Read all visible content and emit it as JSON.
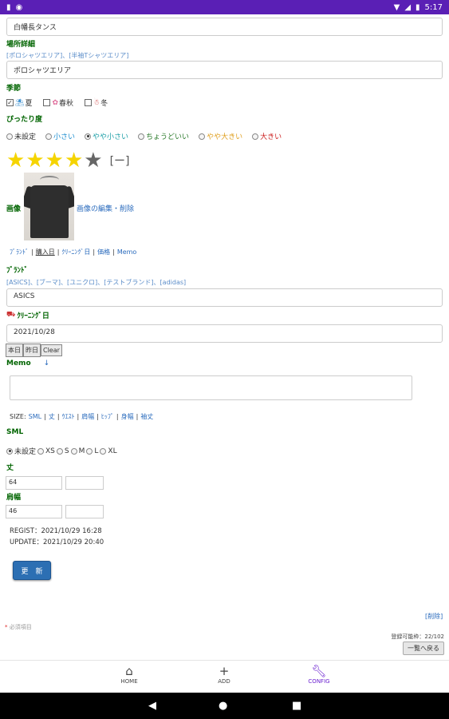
{
  "status": {
    "time": "5:17"
  },
  "top_field": {
    "value": "白幡長タンス"
  },
  "location_detail": {
    "label": "場所詳細",
    "hint": "[ポロシャツエリア]、[半袖Tシャツエリア]",
    "value": "ポロシャツエリア"
  },
  "season": {
    "label": "季節",
    "options": [
      {
        "label": "夏",
        "checked": true
      },
      {
        "label": "春秋",
        "checked": false
      },
      {
        "label": "冬",
        "checked": false
      }
    ]
  },
  "fit": {
    "label": "ぴったり度",
    "options": [
      {
        "label": "未設定",
        "color": "#333333",
        "selected": false
      },
      {
        "label": "小さい",
        "color": "#1f8fd0",
        "selected": false
      },
      {
        "label": "やや小さい",
        "color": "#1fa0a8",
        "selected": true
      },
      {
        "label": "ちょうどいい",
        "color": "#2a7a2a",
        "selected": false
      },
      {
        "label": "やや大きい",
        "color": "#e0a020",
        "selected": false
      },
      {
        "label": "大きい",
        "color": "#cc2222",
        "selected": false
      }
    ]
  },
  "rating": {
    "value": 4,
    "max": 5,
    "clear_label": "[ー]"
  },
  "image": {
    "label": "画像",
    "edit_link": "画像の編集・削除"
  },
  "tabs_line": [
    "ﾌﾞﾗﾝﾄﾞ",
    "購入日",
    "ｸﾘｰﾆﾝｸﾞ日",
    "価格",
    "Memo"
  ],
  "brand": {
    "label": "ﾌﾞﾗﾝﾄﾞ",
    "hint": "[ASICS]、[ブーマ]、[ユニクロ]、[テストブランド]、[adidas]",
    "value": "ASICS"
  },
  "cleaning": {
    "label": "ｸﾘｰﾆﾝｸﾞ日",
    "value": "2021/10/28",
    "buttons": [
      "本日",
      "昨日",
      "Clear"
    ]
  },
  "memo": {
    "label": "Memo",
    "arrow": "↓",
    "value": ""
  },
  "size_line": {
    "prefix": "SIZE:",
    "items": [
      "SML",
      "丈",
      "ｳｴｽﾄ",
      "肩幅",
      "ﾋｯﾌﾟ",
      "身幅",
      "袖丈"
    ]
  },
  "sml": {
    "label": "SML",
    "options": [
      {
        "label": "未設定",
        "selected": true
      },
      {
        "label": "XS",
        "selected": false
      },
      {
        "label": "S",
        "selected": false
      },
      {
        "label": "M",
        "selected": false
      },
      {
        "label": "L",
        "selected": false
      },
      {
        "label": "XL",
        "selected": false
      }
    ]
  },
  "length": {
    "label": "丈",
    "value": "64",
    "value2": ""
  },
  "shoulder": {
    "label": "肩幅",
    "value": "46",
    "value2": ""
  },
  "meta": {
    "regist": "REGIST：2021/10/29 16:28",
    "update": "UPDATE：2021/10/29 20:40"
  },
  "update_button": "更　新",
  "delete_link": "[削除]",
  "required_note": "必須項目",
  "register_count": "登録可能枠：22/102",
  "back_button": "一覧へ戻る",
  "nav": [
    {
      "label": "HOME",
      "icon": "home-icon",
      "active": false
    },
    {
      "label": "ADD",
      "icon": "plus-icon",
      "active": false
    },
    {
      "label": "CONFIG",
      "icon": "wrench-icon",
      "active": true
    }
  ]
}
